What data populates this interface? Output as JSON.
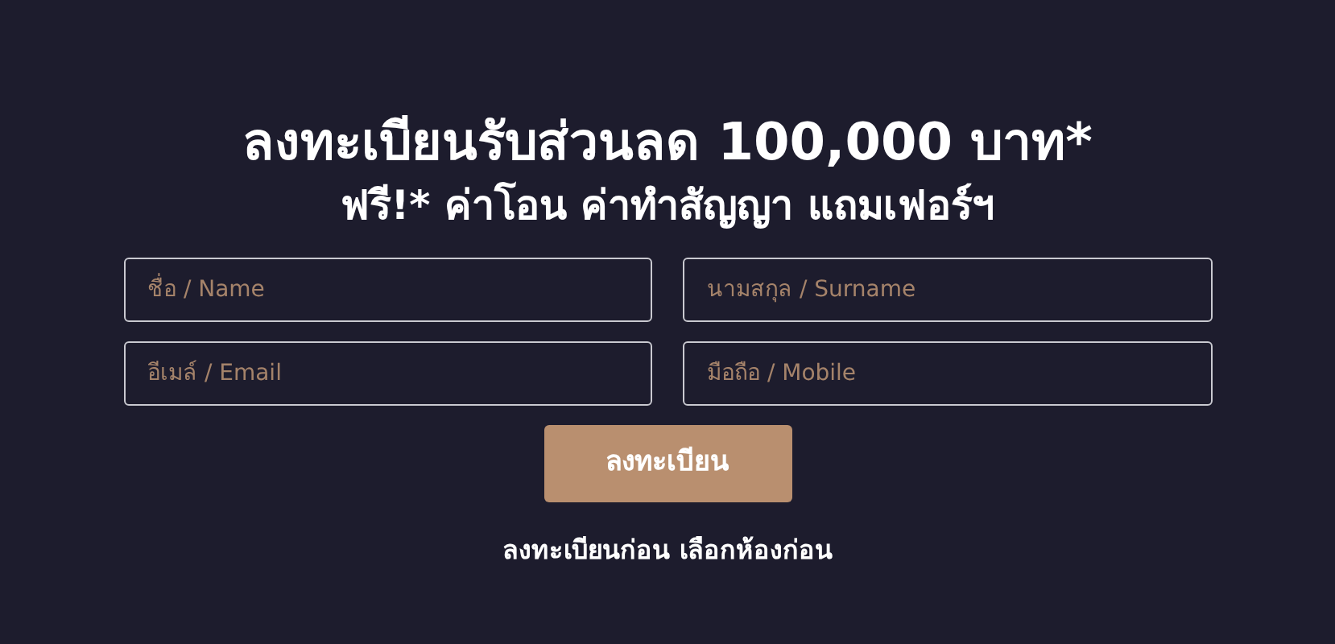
{
  "heading": {
    "line_1": "ลงทะเบียนรับส่วนลด 100,000 บาท*",
    "line_2": "ฟรี!* ค่าโอน ค่าทำสัญญา แถมเฟอร์ฯ"
  },
  "fields": [
    {
      "placeholder": "ชื่อ / Name"
    },
    {
      "placeholder": "นามสกุล / Surname"
    },
    {
      "placeholder": "อีเมล์ / Email"
    },
    {
      "placeholder": "มือถือ / Mobile"
    }
  ],
  "submit_button": "ลงทะเบียน",
  "footer_note": "ลงทะเบียนก่อน เลือกห้องก่อน"
}
